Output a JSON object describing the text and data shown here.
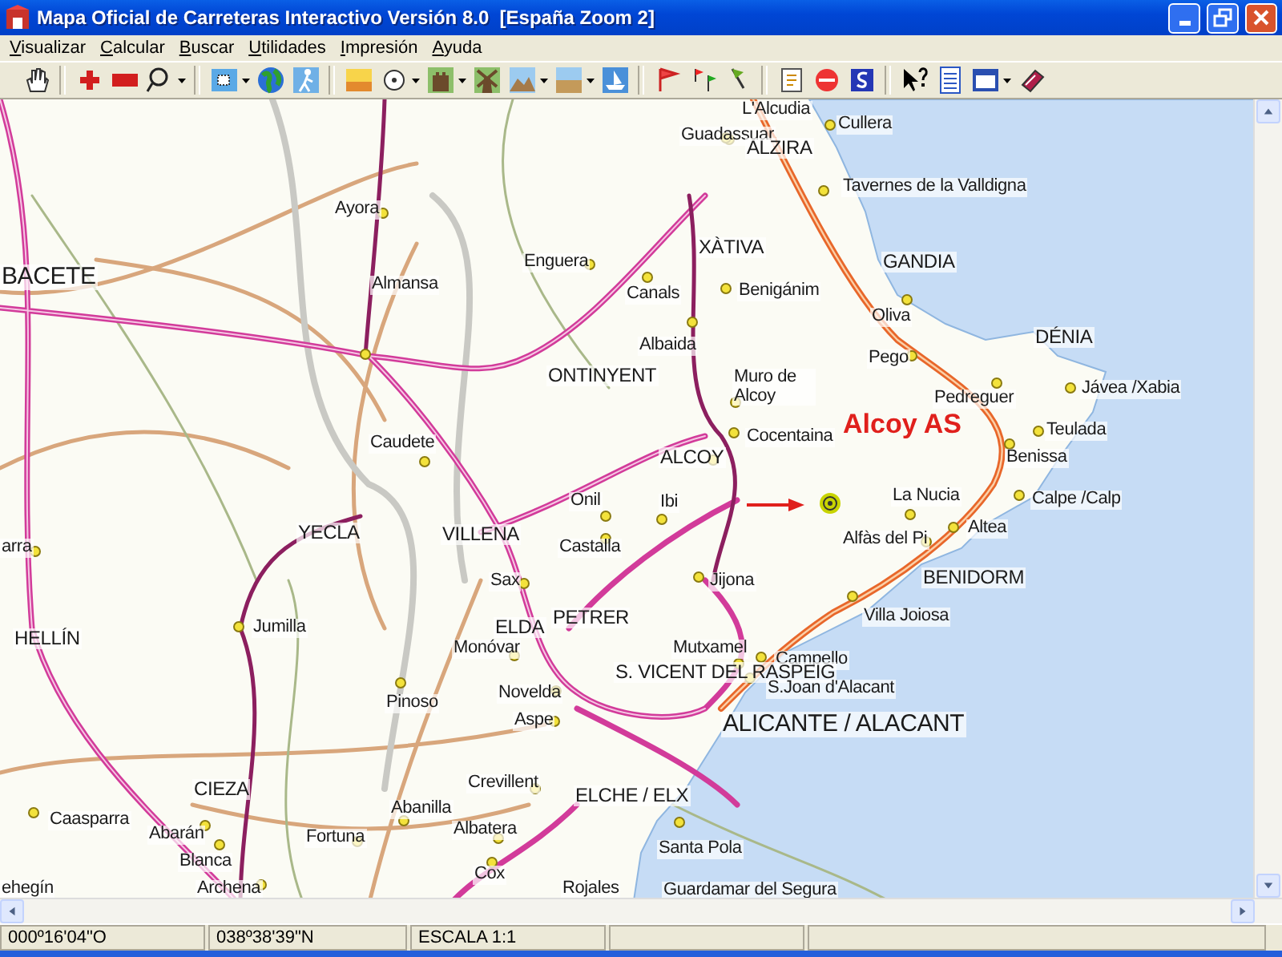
{
  "window": {
    "title": "Mapa Oficial de Carreteras Interactivo Versión 8.0  [España Zoom 2]"
  },
  "menu": [
    "Visualizar",
    "Calcular",
    "Buscar",
    "Utilidades",
    "Impresión",
    "Ayuda"
  ],
  "map": {
    "places": [
      {
        "name": "L'Alcudia",
        "kind": "town"
      },
      {
        "name": "Cullera",
        "kind": "town"
      },
      {
        "name": "Guadassuar",
        "kind": "town"
      },
      {
        "name": "ALZIRA",
        "kind": "city"
      },
      {
        "name": "Tavernes de la Valldigna",
        "kind": "town"
      },
      {
        "name": "Ayora",
        "kind": "town"
      },
      {
        "name": "XÀTIVA",
        "kind": "city"
      },
      {
        "name": "Enguera",
        "kind": "town"
      },
      {
        "name": "GANDIA",
        "kind": "city"
      },
      {
        "name": "BACETE",
        "kind": "capital"
      },
      {
        "name": "Almansa",
        "kind": "town"
      },
      {
        "name": "Canals",
        "kind": "town"
      },
      {
        "name": "Benigánim",
        "kind": "town"
      },
      {
        "name": "Oliva",
        "kind": "town"
      },
      {
        "name": "Albaida",
        "kind": "town"
      },
      {
        "name": "Pego",
        "kind": "town"
      },
      {
        "name": "DÉNIA",
        "kind": "city"
      },
      {
        "name": "ONTINYENT",
        "kind": "city"
      },
      {
        "name": "Muro de Alcoy",
        "kind": "town"
      },
      {
        "name": "Pedreguer",
        "kind": "town"
      },
      {
        "name": "Jávea /Xabia",
        "kind": "town"
      },
      {
        "name": "Caudete",
        "kind": "town"
      },
      {
        "name": "Cocentaina",
        "kind": "town"
      },
      {
        "name": "Teulada",
        "kind": "town"
      },
      {
        "name": "ALCOY",
        "kind": "city"
      },
      {
        "name": "Benissa",
        "kind": "town"
      },
      {
        "name": "Onil",
        "kind": "town"
      },
      {
        "name": "Ibi",
        "kind": "town"
      },
      {
        "name": "La Nucia",
        "kind": "town"
      },
      {
        "name": "Calpe /Calp",
        "kind": "town"
      },
      {
        "name": "arra",
        "kind": "town"
      },
      {
        "name": "YECLA",
        "kind": "city"
      },
      {
        "name": "VILLENA",
        "kind": "city"
      },
      {
        "name": "Castalla",
        "kind": "town"
      },
      {
        "name": "Alfàs del Pi",
        "kind": "town"
      },
      {
        "name": "Altea",
        "kind": "town"
      },
      {
        "name": "Sax",
        "kind": "town"
      },
      {
        "name": "Jijona",
        "kind": "town"
      },
      {
        "name": "BENIDORM",
        "kind": "city"
      },
      {
        "name": "HELLÍN",
        "kind": "city"
      },
      {
        "name": "Jumilla",
        "kind": "town"
      },
      {
        "name": "ELDA",
        "kind": "city"
      },
      {
        "name": "PETRER",
        "kind": "city"
      },
      {
        "name": "Villa Joiosa",
        "kind": "town"
      },
      {
        "name": "Monóvar",
        "kind": "town"
      },
      {
        "name": "Mutxamel",
        "kind": "town"
      },
      {
        "name": "Campello",
        "kind": "town"
      },
      {
        "name": "S. VICENT DEL RASPEIG",
        "kind": "city"
      },
      {
        "name": "Pinoso",
        "kind": "town"
      },
      {
        "name": "Novelda",
        "kind": "town"
      },
      {
        "name": "S.Joan d'Alacant",
        "kind": "town"
      },
      {
        "name": "Aspe",
        "kind": "town"
      },
      {
        "name": "ALICANTE / ALACANT",
        "kind": "capital"
      },
      {
        "name": "CIEZA",
        "kind": "city"
      },
      {
        "name": "Crevillent",
        "kind": "town"
      },
      {
        "name": "ELCHE / ELX",
        "kind": "city"
      },
      {
        "name": "Caasparra",
        "kind": "town"
      },
      {
        "name": "Abanilla",
        "kind": "town"
      },
      {
        "name": "Abarán",
        "kind": "town"
      },
      {
        "name": "Fortuna",
        "kind": "town"
      },
      {
        "name": "Albatera",
        "kind": "town"
      },
      {
        "name": "Santa Pola",
        "kind": "town"
      },
      {
        "name": "Blanca",
        "kind": "town"
      },
      {
        "name": "Cox",
        "kind": "town"
      },
      {
        "name": "ehegín",
        "kind": "town"
      },
      {
        "name": "Archena",
        "kind": "town"
      },
      {
        "name": "Rojales",
        "kind": "town"
      },
      {
        "name": "Guardamar del Segura",
        "kind": "town"
      }
    ],
    "annotation": {
      "label": "Alcoy AS"
    }
  },
  "status_bar": [
    "000º16'04\"O",
    "038º38'39\"N",
    "ESCALA 1:1"
  ]
}
